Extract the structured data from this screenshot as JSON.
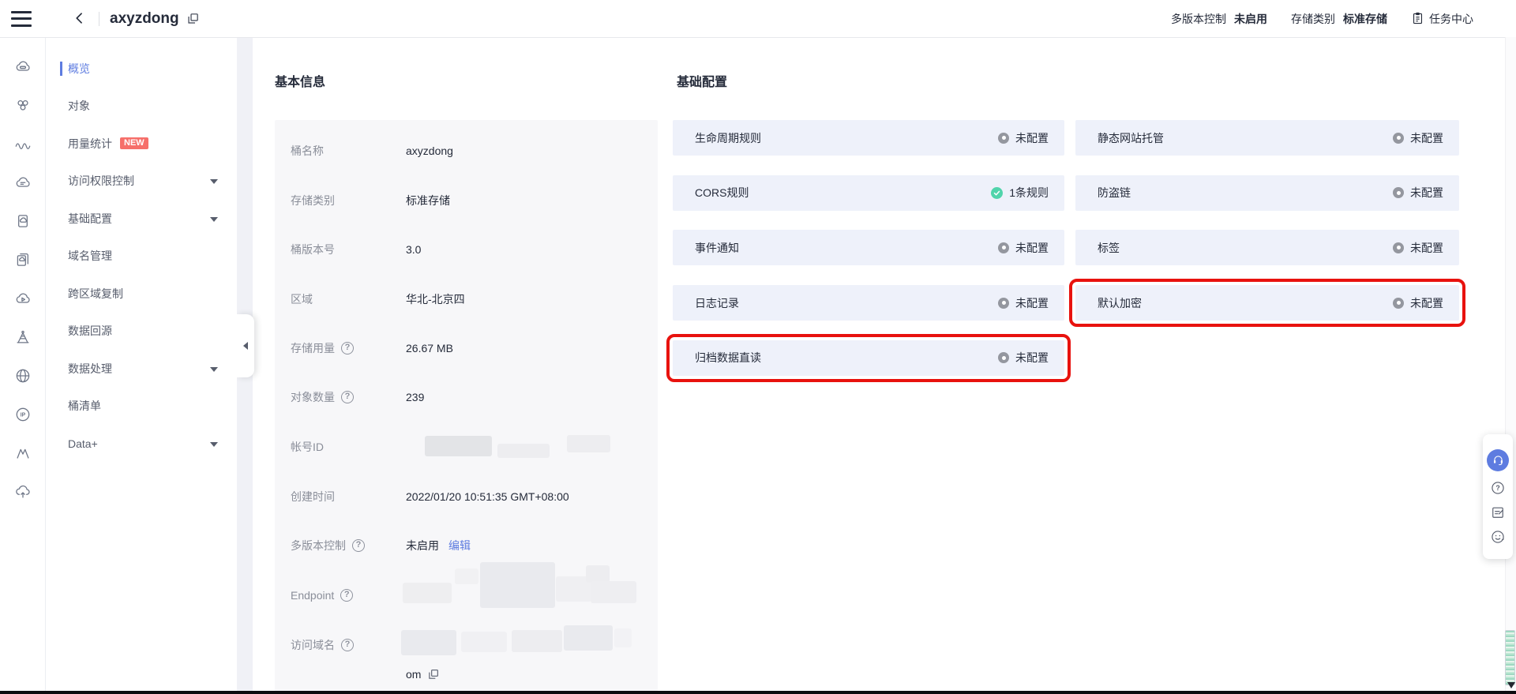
{
  "header": {
    "title": "axyzdong",
    "versioning_label": "多版本控制",
    "versioning_value": "未启用",
    "storage_class_label": "存储类别",
    "storage_class_value": "标准存储",
    "task_center_label": "任务中心"
  },
  "sidebar": {
    "rail_icons": [
      "cloud-server",
      "resource-cluster",
      "usage-waves",
      "cloud-console",
      "cloud-document",
      "documents",
      "cloud-media",
      "beacon",
      "globe",
      "ip",
      "cdn",
      "cloud-upload"
    ],
    "items": [
      {
        "id": "overview",
        "label": "概览",
        "active": true
      },
      {
        "id": "objects",
        "label": "对象"
      },
      {
        "id": "metrics",
        "label": "用量统计",
        "badge": "NEW"
      },
      {
        "id": "permissions",
        "label": "访问权限控制",
        "expandable": true
      },
      {
        "id": "basic-configurations",
        "label": "基础配置",
        "expandable": true
      },
      {
        "id": "domain-management",
        "label": "域名管理"
      },
      {
        "id": "cross-region-replication",
        "label": "跨区域复制"
      },
      {
        "id": "back-to-source",
        "label": "数据回源"
      },
      {
        "id": "data-processing",
        "label": "数据处理",
        "expandable": true
      },
      {
        "id": "inventory",
        "label": "桶清单"
      },
      {
        "id": "data-plus",
        "label": "Data+",
        "expandable": true
      }
    ]
  },
  "basic_info": {
    "title": "基本信息",
    "rows": [
      {
        "id": "bucket-name",
        "label": "桶名称",
        "value": "axyzdong"
      },
      {
        "id": "storage-class",
        "label": "存储类别",
        "value": "标准存储"
      },
      {
        "id": "bucket-version",
        "label": "桶版本号",
        "value": "3.0"
      },
      {
        "id": "region",
        "label": "区域",
        "value": "华北-北京四"
      },
      {
        "id": "storage-usage",
        "label": "存储用量",
        "help": true,
        "value": "26.67 MB"
      },
      {
        "id": "object-count",
        "label": "对象数量",
        "help": true,
        "value": "239"
      },
      {
        "id": "account-id",
        "label": "帐号ID",
        "redacted": true
      },
      {
        "id": "created-time",
        "label": "创建时间",
        "value": "2022/01/20 10:51:35 GMT+08:00"
      },
      {
        "id": "versioning",
        "label": "多版本控制",
        "help": true,
        "value": "未启用",
        "link": "编辑"
      },
      {
        "id": "endpoint",
        "label": "Endpoint",
        "help": true,
        "redacted": true
      },
      {
        "id": "access-domain",
        "label": "访问域名",
        "help": true,
        "redacted": true,
        "value_tail": "om"
      }
    ]
  },
  "basic_config": {
    "title": "基础配置",
    "columns": [
      [
        {
          "id": "lifecycle",
          "label": "生命周期规则",
          "status": "未配置",
          "state": "none"
        },
        {
          "id": "cors",
          "label": "CORS规则",
          "status": "1条规则",
          "state": "ok"
        },
        {
          "id": "event-notification",
          "label": "事件通知",
          "status": "未配置",
          "state": "none"
        },
        {
          "id": "logging",
          "label": "日志记录",
          "status": "未配置",
          "state": "none"
        },
        {
          "id": "archive-direct-read",
          "label": "归档数据直读",
          "status": "未配置",
          "state": "none",
          "highlighted": true
        }
      ],
      [
        {
          "id": "static-website",
          "label": "静态网站托管",
          "status": "未配置",
          "state": "none"
        },
        {
          "id": "referer-validation",
          "label": "防盗链",
          "status": "未配置",
          "state": "none"
        },
        {
          "id": "tags",
          "label": "标签",
          "status": "未配置",
          "state": "none"
        },
        {
          "id": "default-encryption",
          "label": "默认加密",
          "status": "未配置",
          "state": "none",
          "highlighted": true
        }
      ]
    ]
  },
  "float_panel": {
    "icons": [
      {
        "name": "support-headset",
        "primary": true
      },
      {
        "name": "help-circle"
      },
      {
        "name": "feedback-form"
      },
      {
        "name": "smiley"
      }
    ]
  },
  "colors": {
    "accent_blue": "#5e7ce0",
    "badge_red": "#f66f6a",
    "highlight_red": "#e8120e",
    "success_green": "#50d4ab",
    "config_card_bg": "#eef1fa",
    "info_card_bg": "#f7f7f9"
  }
}
